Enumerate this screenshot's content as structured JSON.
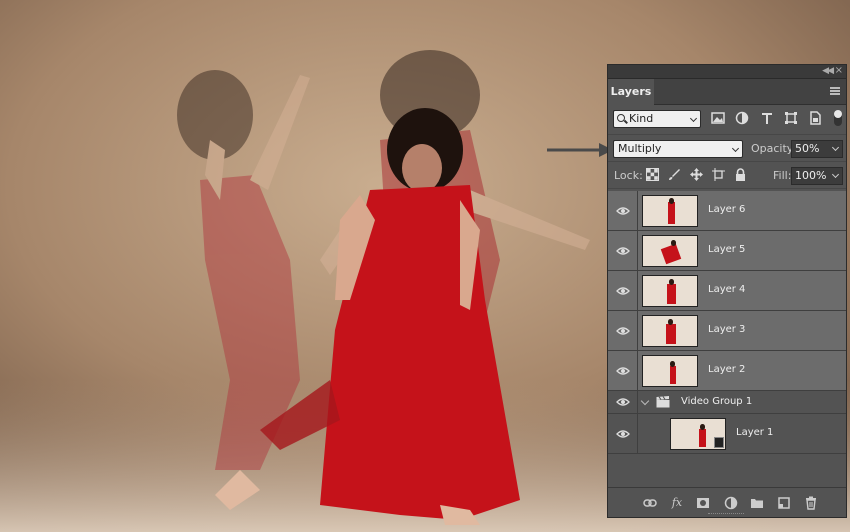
{
  "panel": {
    "tab_label": "Layers",
    "filter": {
      "selected": "Kind"
    },
    "blend": {
      "mode": "Multiply",
      "opacity_label": "Opacity:",
      "opacity_value": "50%"
    },
    "lock": {
      "label": "Lock:",
      "fill_label": "Fill:",
      "fill_value": "100%"
    },
    "layers": [
      {
        "name": "Layer 6",
        "selected": true,
        "visible": true
      },
      {
        "name": "Layer 5",
        "selected": true,
        "visible": true
      },
      {
        "name": "Layer 4",
        "selected": true,
        "visible": true
      },
      {
        "name": "Layer 3",
        "selected": true,
        "visible": true
      },
      {
        "name": "Layer 2",
        "selected": true,
        "visible": true
      },
      {
        "name": "Video Group 1",
        "type": "video-group",
        "expanded": true,
        "visible": true
      },
      {
        "name": "Layer 1",
        "nested": true,
        "visible": true
      }
    ],
    "bottom_icons": [
      "link-layers-icon",
      "fx-icon",
      "layer-mask-icon",
      "adjustment-layer-icon",
      "new-group-icon",
      "new-layer-icon",
      "trash-icon"
    ]
  },
  "colors": {
    "panel_bg": "#535353",
    "selected_row": "#6c6c6c",
    "dress_red": "#c5121a"
  }
}
